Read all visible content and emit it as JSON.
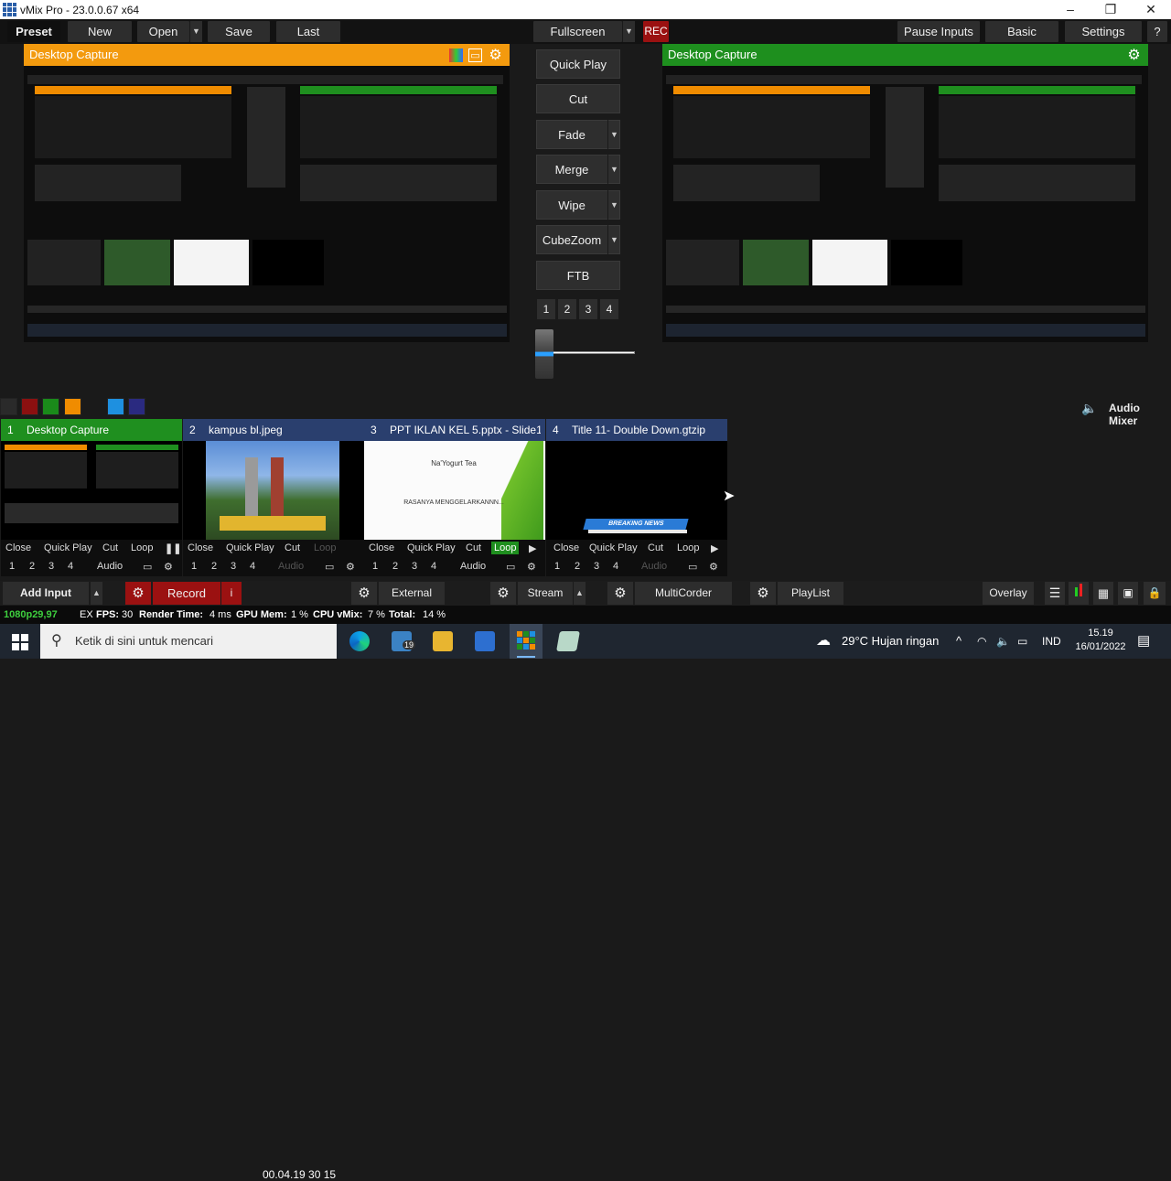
{
  "window": {
    "title": "vMix Pro - 23.0.0.67 x64",
    "minimize": "–",
    "maximize": "❐",
    "close": "✕"
  },
  "topbar": {
    "preset": "Preset",
    "new": "New",
    "open": "Open",
    "save": "Save",
    "last": "Last",
    "fullscreen": "Fullscreen",
    "rec": "REC",
    "pause_inputs": "Pause Inputs",
    "basic": "Basic",
    "settings": "Settings",
    "help": "?"
  },
  "preview": {
    "title": "Desktop Capture",
    "color": "#f39a0e"
  },
  "output": {
    "title": "Desktop Capture",
    "color": "#1e8f1e"
  },
  "transitions": {
    "quick_play": "Quick Play",
    "cut": "Cut",
    "fade": "Fade",
    "merge": "Merge",
    "wipe": "Wipe",
    "cubezoom": "CubeZoom",
    "ftb": "FTB",
    "numbers": [
      "1",
      "2",
      "3",
      "4"
    ],
    "tbar_position": 0.0
  },
  "swatches": [
    "#2a2a2a",
    "#8b1010",
    "#1a8a1a",
    "#f08c00",
    "#1e90e0",
    "#2a2a80"
  ],
  "audio_mixer": "Audio Mixer",
  "inputs": [
    {
      "number": "1",
      "name": "Desktop Capture",
      "header_color": "#1f8f1f",
      "controls": [
        "Close",
        "Quick Play",
        "Cut",
        "Loop"
      ],
      "action_icon": "pause",
      "overlays": [
        "1",
        "2",
        "3",
        "4"
      ],
      "audio": "Audio"
    },
    {
      "number": "2",
      "name": "kampus bl.jpeg",
      "header_color": "#2a3f6e",
      "controls": [
        "Close",
        "Quick Play",
        "Cut",
        "Loop"
      ],
      "overlays": [
        "1",
        "2",
        "3",
        "4"
      ],
      "audio": "Audio"
    },
    {
      "number": "3",
      "name": "PPT IKLAN KEL 5.pptx - Slide1",
      "header_color": "#2a3f6e",
      "controls": [
        "Close",
        "Quick Play",
        "Cut",
        "Loop"
      ],
      "action_icon": "play",
      "overlays": [
        "1",
        "2",
        "3",
        "4"
      ],
      "audio": "Audio",
      "slide_title": "Na'Yogurt Tea",
      "slide_body": "RASANYA MENGGELARKANNN..."
    },
    {
      "number": "4",
      "name": "Title 11- Double Down.gtzip",
      "header_color": "#2a3f6e",
      "controls": [
        "Close",
        "Quick Play",
        "Cut",
        "Loop"
      ],
      "action_icon": "play",
      "overlays": [
        "1",
        "2",
        "3",
        "4"
      ],
      "audio": "Audio",
      "banner": "BREAKING NEWS"
    }
  ],
  "controlbar": {
    "add_input": "Add Input",
    "record": "Record",
    "record_info": "i",
    "timecode": "00.04.19 30 15",
    "external": "External",
    "stream": "Stream",
    "multicorder": "MultiCorder",
    "playlist": "PlayList",
    "overlay": "Overlay"
  },
  "status": {
    "format": "1080p29,97",
    "ex": "EX",
    "fps_label": "FPS:",
    "fps": "30",
    "render_label": "Render Time:",
    "render": "4 ms",
    "gpu_label": "GPU Mem:",
    "gpu": "1 %",
    "cpu_label": "CPU vMix:",
    "cpu": "7 %",
    "total_label": "Total:",
    "total": "14 %"
  },
  "taskbar": {
    "search_placeholder": "Ketik di sini untuk mencari",
    "mail_badge": "19",
    "weather": "29°C  Hujan ringan",
    "lang": "IND",
    "time": "15.19",
    "date": "16/01/2022"
  }
}
